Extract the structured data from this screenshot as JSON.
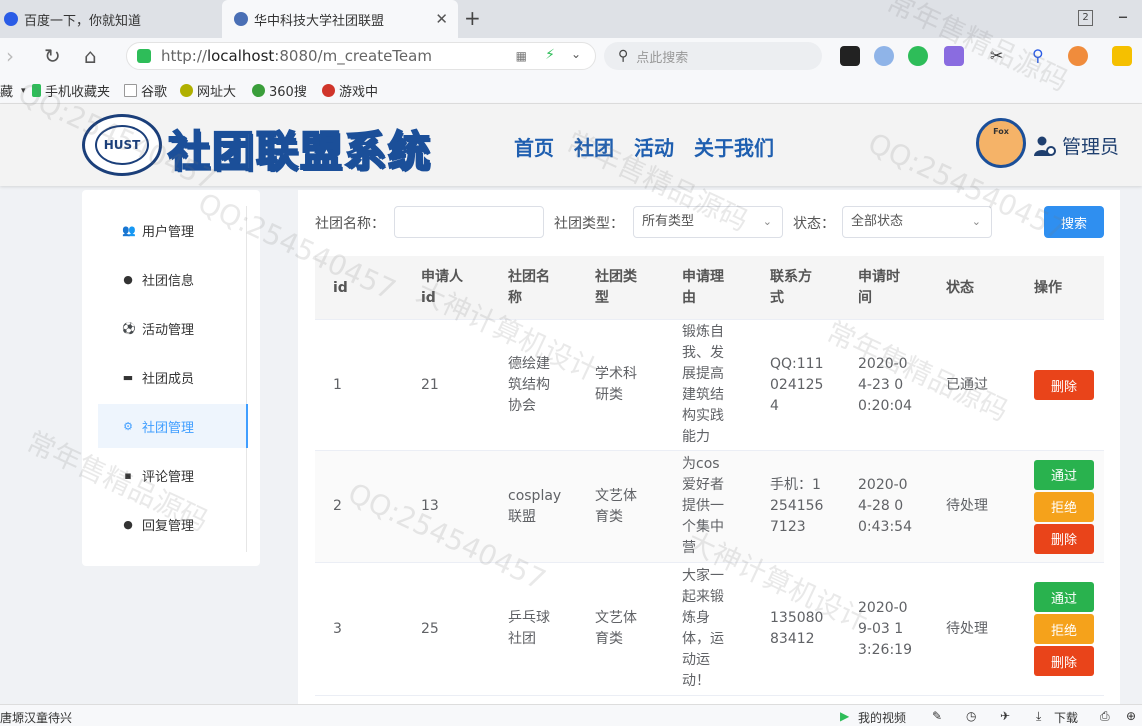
{
  "browser": {
    "tabs": [
      {
        "title": "百度一下，你就知道"
      },
      {
        "title": "华中科技大学社团联盟"
      }
    ],
    "tab_count": "2",
    "url_prefix": "http://",
    "url_host": "localhost",
    "url_rest": ":8080/m_createTeam",
    "search_placeholder": "点此搜索",
    "bookmarks": [
      {
        "label": "藏"
      },
      {
        "label": "手机收藏夹"
      },
      {
        "label": "谷歌"
      },
      {
        "label": "网址大"
      },
      {
        "label": "360搜"
      },
      {
        "label": "游戏中"
      }
    ],
    "status_left": "唐塬汉童待兴",
    "status_video": "我的视频",
    "status_download": "下载"
  },
  "header": {
    "logo_seal_text": "HUST",
    "logo_title": "社团联盟系统",
    "nav": [
      "首页",
      "社团",
      "活动",
      "关于我们"
    ],
    "avatar_text": "Fox",
    "user_label": "管理员"
  },
  "sidebar": {
    "items": [
      {
        "label": "用户管理",
        "icon": "users-icon"
      },
      {
        "label": "社团信息",
        "icon": "chat-icon"
      },
      {
        "label": "活动管理",
        "icon": "ball-icon"
      },
      {
        "label": "社团成员",
        "icon": "folder-icon"
      },
      {
        "label": "社团管理",
        "icon": "gear-icon"
      },
      {
        "label": "评论管理",
        "icon": "comment-icon"
      },
      {
        "label": "回复管理",
        "icon": "reply-icon"
      }
    ],
    "active_index": 4
  },
  "filter": {
    "name_label": "社团名称：",
    "name_value": "",
    "type_label": "社团类型：",
    "type_value": "所有类型",
    "status_label": "状态：",
    "status_value": "全部状态",
    "search_button": "搜索"
  },
  "table": {
    "headers": [
      "id",
      "申请人id",
      "社团名称",
      "社团类型",
      "申请理由",
      "联系方式",
      "申请时间",
      "状态",
      "操作"
    ],
    "rows": [
      {
        "id": "1",
        "applicant": "21",
        "name": "德绘建筑结构协会",
        "type": "学术科研类",
        "reason": "锻炼自我、发展提高建筑结构实践能力",
        "contact": "QQ:1110241254",
        "time": "2020-04-23 00:20:04",
        "status": "已通过",
        "actions": [
          "删除"
        ]
      },
      {
        "id": "2",
        "applicant": "13",
        "name": "cosplay联盟",
        "type": "文艺体育类",
        "reason": "为cos爱好者提供一个集中营",
        "contact": "手机：12541567123",
        "time": "2020-04-28 00:43:54",
        "status": "待处理",
        "actions": [
          "通过",
          "拒绝",
          "删除"
        ]
      },
      {
        "id": "3",
        "applicant": "25",
        "name": "乒乓球社团",
        "type": "文艺体育类",
        "reason": "大家一起来锻炼身体，运动运动！",
        "contact": "13508083412",
        "time": "2020-09-03 13:26:19",
        "status": "待处理",
        "actions": [
          "通过",
          "拒绝",
          "删除"
        ]
      }
    ]
  },
  "colors": {
    "primary": "#2f8ff0",
    "pass": "#29b24e",
    "reject": "#f5a21b",
    "delete": "#e9441a",
    "nav_blue": "#1f5fb0"
  },
  "watermark": [
    "QQ:254540457",
    "常年售精品源码",
    "大神计算机设计"
  ]
}
